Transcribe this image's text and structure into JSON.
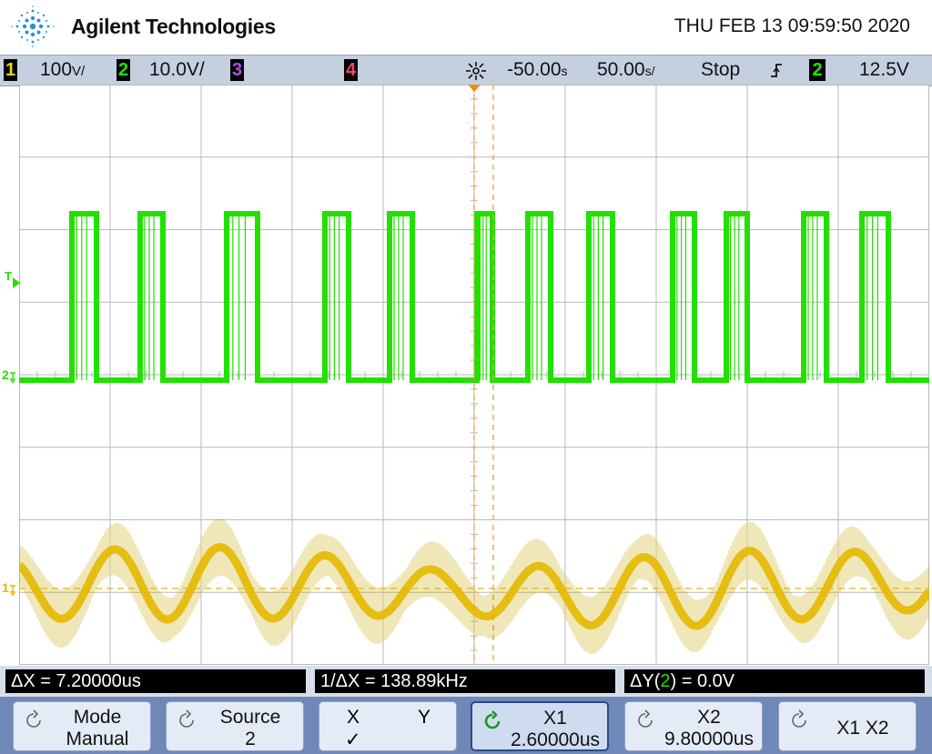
{
  "header": {
    "brand": "Agilent Technologies",
    "datetime": "THU FEB 13 09:59:50 2020"
  },
  "status": {
    "ch1": {
      "num": "1",
      "scale": "100",
      "unit": "V/",
      "color": "#f2d400"
    },
    "ch2": {
      "num": "2",
      "scale": "10.0V/",
      "color": "#22e000"
    },
    "ch3": {
      "num": "3",
      "color": "#b14ce0"
    },
    "ch4": {
      "num": "4",
      "color": "#ff3d6e"
    },
    "delay": "-50.00",
    "delay_unit": "s",
    "timebase": "50.00",
    "timebase_unit": "s/",
    "run_state": "Stop",
    "trigger_slope": "rising",
    "trigger_source": "2",
    "trigger_level": "12.5V"
  },
  "screen_markers": {
    "trigger_level_label": "T",
    "ch2_ground_label": "2",
    "ch1_ground_label": "1"
  },
  "colors": {
    "ch1": "#e6b800",
    "ch1_envelope": "#c9a800",
    "ch2": "#22e000",
    "cursor": "#f0a030",
    "grid": "#b9b9b9",
    "softkey_bg": "#e4ebf6"
  },
  "measurements": {
    "delta_x": "ΔX = 7.20000us",
    "inv_delta_x": "1/ΔX = 138.89kHz",
    "delta_y_prefix": "ΔY(",
    "delta_y_channel": "2",
    "delta_y_suffix": ") = 0.0V"
  },
  "softkeys": [
    {
      "top": "Mode",
      "bottom": "Manual",
      "icon": "rotate-knob-icon"
    },
    {
      "top": "Source",
      "bottom": "2",
      "icon": "rotate-knob-icon"
    },
    {
      "top_left": "X",
      "top_right": "Y",
      "bottom": "✓",
      "icon": "checkmark-icon"
    },
    {
      "top": "X1",
      "bottom": "2.60000us",
      "icon": "rotate-knob-active-icon"
    },
    {
      "top": "X2",
      "bottom": "9.80000us",
      "icon": "rotate-knob-icon"
    },
    {
      "middle": "X1 X2",
      "icon": "rotate-knob-icon"
    }
  ]
}
